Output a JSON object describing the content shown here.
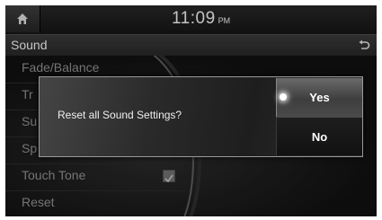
{
  "status_bar": {
    "time": "11:09",
    "ampm": "PM",
    "home_icon": "home-icon"
  },
  "title_bar": {
    "title": "Sound",
    "back_icon": "back-arrow-icon"
  },
  "menu": {
    "items": [
      {
        "label": "Fade/Balance"
      },
      {
        "label": "Tr"
      },
      {
        "label": "Su"
      },
      {
        "label": "Sp"
      },
      {
        "label": "Touch Tone",
        "checked": true
      },
      {
        "label": "Reset"
      }
    ]
  },
  "dialog": {
    "message": "Reset all Sound Settings?",
    "yes_label": "Yes",
    "no_label": "No"
  },
  "colors": {
    "screen_bg": "#0b0b0b",
    "popup_border": "#9a9a9a",
    "text": "#e8e8e8"
  }
}
